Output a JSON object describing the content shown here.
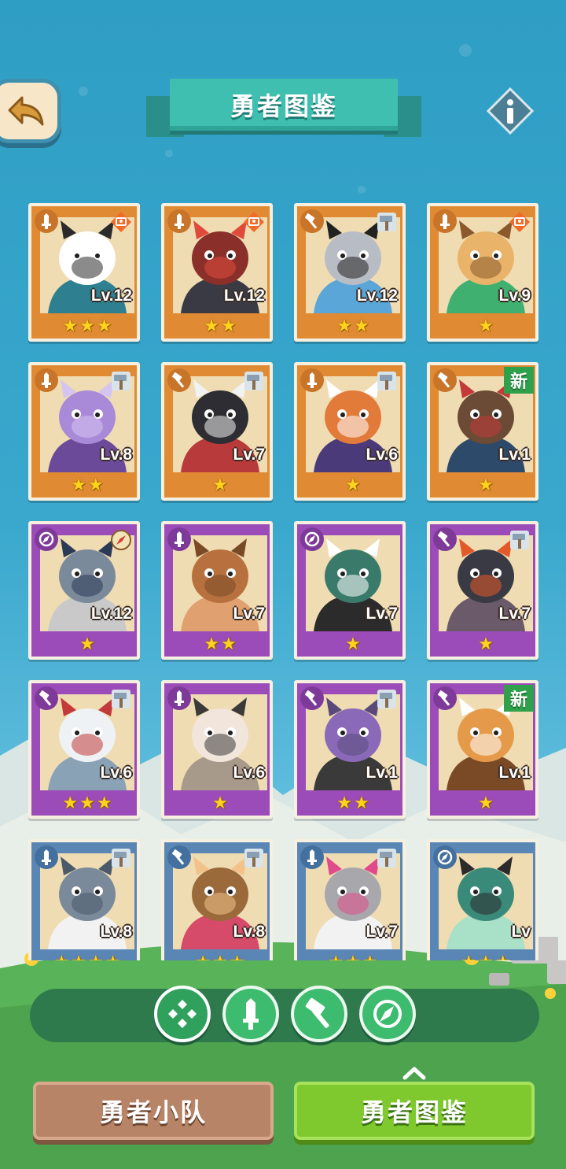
{
  "header": {
    "title": "勇者图鉴"
  },
  "buttons": {
    "back_icon": "back-arrow-icon",
    "info_icon": "info-icon"
  },
  "rarity_colors": {
    "orange": "#e08a33",
    "purple": "#9b4cb8",
    "blue": "#5a86b6"
  },
  "heroes": [
    {
      "level": "Lv.12",
      "stars": 3,
      "rarity": "orange",
      "class": "sword",
      "weapon": "rare-gear",
      "subject": "panda"
    },
    {
      "level": "Lv.12",
      "stars": 2,
      "rarity": "orange",
      "class": "sword",
      "weapon": "rare-gear",
      "subject": "horned-warrior"
    },
    {
      "level": "Lv.12",
      "stars": 2,
      "rarity": "orange",
      "class": "hammer",
      "weapon": "hammer",
      "subject": "hooded-gorilla"
    },
    {
      "level": "Lv.9",
      "stars": 1,
      "rarity": "orange",
      "class": "sword",
      "weapon": "rare-gear",
      "subject": "lynx"
    },
    {
      "level": "Lv.8",
      "stars": 2,
      "rarity": "orange",
      "class": "sword",
      "weapon": "hammer",
      "subject": "elephant"
    },
    {
      "level": "Lv.7",
      "stars": 1,
      "rarity": "orange",
      "class": "hammer",
      "weapon": "hammer",
      "subject": "wolf"
    },
    {
      "level": "Lv.6",
      "stars": 1,
      "rarity": "orange",
      "class": "sword",
      "weapon": "hammer",
      "subject": "red-panda"
    },
    {
      "level": "Lv.1",
      "stars": 1,
      "rarity": "orange",
      "class": "hammer",
      "weapon": "new",
      "subject": "captain-bear"
    },
    {
      "level": "Lv.12",
      "stars": 1,
      "rarity": "purple",
      "class": "compass",
      "weapon": "compass",
      "subject": "shark-ninja"
    },
    {
      "level": "Lv.7",
      "stars": 2,
      "rarity": "purple",
      "class": "sword",
      "weapon": "none",
      "subject": "gecko"
    },
    {
      "level": "Lv.7",
      "stars": 1,
      "rarity": "purple",
      "class": "compass",
      "weapon": "none",
      "subject": "penguin-duo"
    },
    {
      "level": "Lv.7",
      "stars": 1,
      "rarity": "purple",
      "class": "hammer",
      "weapon": "hammer",
      "subject": "black-cat"
    },
    {
      "level": "Lv.6",
      "stars": 3,
      "rarity": "purple",
      "class": "hammer",
      "weapon": "hammer",
      "subject": "white-dragon"
    },
    {
      "level": "Lv.6",
      "stars": 1,
      "rarity": "purple",
      "class": "sword",
      "weapon": "none",
      "subject": "ram"
    },
    {
      "level": "Lv.1",
      "stars": 2,
      "rarity": "purple",
      "class": "hammer",
      "weapon": "hammer",
      "subject": "rhino"
    },
    {
      "level": "Lv.1",
      "stars": 1,
      "rarity": "purple",
      "class": "hammer",
      "weapon": "new",
      "subject": "pangolin"
    },
    {
      "level": "Lv.8",
      "stars": 4,
      "rarity": "blue",
      "class": "sword",
      "weapon": "hammer",
      "subject": "rabbit"
    },
    {
      "level": "Lv.8",
      "stars": 3,
      "rarity": "blue",
      "class": "hammer",
      "weapon": "hammer",
      "subject": "hooded-girl"
    },
    {
      "level": "Lv.7",
      "stars": 3,
      "rarity": "blue",
      "class": "sword",
      "weapon": "hammer",
      "subject": "grey-cat"
    },
    {
      "level": "Lv",
      "stars": 3,
      "rarity": "blue",
      "class": "compass",
      "weapon": "none",
      "subject": "frog"
    }
  ],
  "badges": {
    "new_label": "新"
  },
  "filters": [
    {
      "icon": "all-classes-icon",
      "active": true
    },
    {
      "icon": "sword-icon",
      "active": false
    },
    {
      "icon": "hammer-icon",
      "active": false
    },
    {
      "icon": "compass-icon",
      "active": false
    }
  ],
  "tabs": {
    "team_label": "勇者小队",
    "codex_label": "勇者图鉴"
  }
}
